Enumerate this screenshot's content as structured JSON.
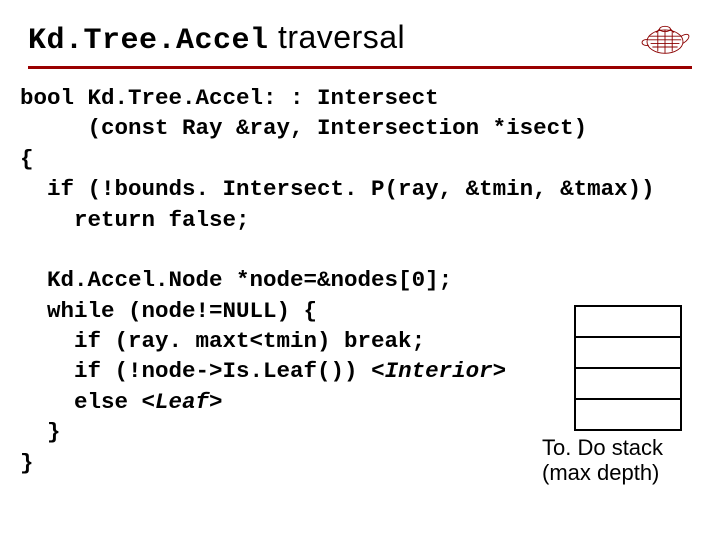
{
  "title": {
    "mono": "Kd.Tree.Accel",
    "rest": " traversal"
  },
  "code": {
    "l1": "bool Kd.Tree.Accel: : Intersect",
    "l2": "     (const Ray &ray, Intersection *isect)",
    "l3": "{",
    "l4": "  if (!bounds. Intersect. P(ray, &tmin, &tmax))",
    "l5": "    return false;",
    "blank1": "",
    "l6": "  Kd.Accel.Node *node=&nodes[0];",
    "l7": "  while (node!=NULL) {",
    "l8": "    if (ray. maxt<tmin) break;",
    "l9a": "    if (!node->Is.Leaf()) ",
    "l9b": "<Interior>",
    "l10a": "    else ",
    "l10b": "<Leaf>",
    "l11": "  }",
    "l12": "}"
  },
  "stack": {
    "label_line1": "To. Do stack",
    "label_line2": "(max depth)"
  }
}
